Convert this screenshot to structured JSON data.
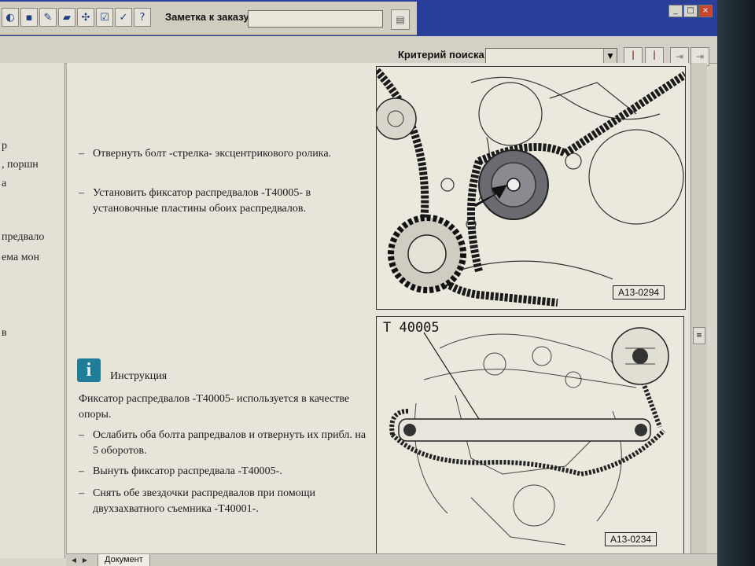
{
  "toolbar": {
    "order_note_label": "Заметка к заказу:",
    "order_note_value": "",
    "icons": [
      "doc-icon",
      "save-icon",
      "edit-icon",
      "car-icon",
      "network-icon",
      "checklist-icon",
      "approve-icon",
      "help-icon"
    ]
  },
  "search": {
    "label": "Критерий поиска:",
    "value": ""
  },
  "left_pane": {
    "fragments": [
      "р",
      ", поршн",
      "а",
      "предвало",
      "ема мон",
      "в"
    ]
  },
  "document": {
    "step1": "Отвернуть болт -стрелка- эксцентрикового ролика.",
    "step2": "Установить фиксатор распредвалов -T40005- в установочные пластины обоих распредвалов.",
    "info_label": "Инструкция",
    "info_text": "Фиксатор распредвалов -T40005- используется в качестве опоры.",
    "step3": "Ослабить оба болта рапредвалов и отвернуть их прибл. на 5 оборотов.",
    "step4": "Вынуть фиксатор распредвала -T40005-.",
    "step5": "Снять обе звездочки распредвалов при помощи двухзахватного съемника -T40001-.",
    "dash": "–"
  },
  "figures": {
    "fig1_label": "A13-0294",
    "fig2_label": "A13-0234",
    "fig2_tool": "T 40005"
  },
  "tabs": {
    "active": "Документ"
  }
}
